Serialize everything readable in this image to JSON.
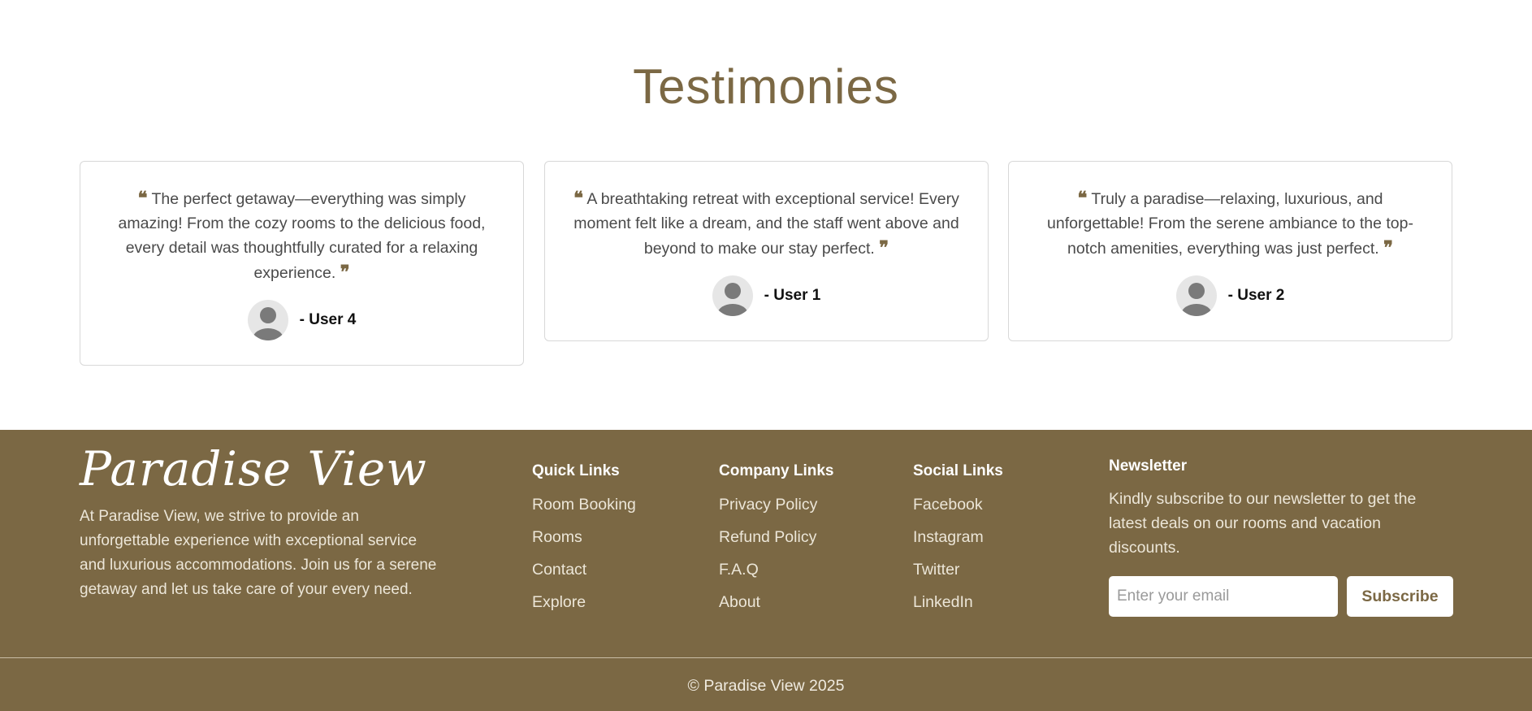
{
  "testimonies": {
    "title": "Testimonies",
    "items": [
      {
        "quote": "The perfect getaway—everything was simply amazing! From the cozy rooms to the delicious food, every detail was thoughtfully curated for a relaxing experience.",
        "author": "- User 4"
      },
      {
        "quote": "A breathtaking retreat with exceptional service! Every moment felt like a dream, and the staff went above and beyond to make our stay perfect.",
        "author": "- User 1"
      },
      {
        "quote": "Truly a paradise—relaxing, luxurious, and unforgettable! From the serene ambiance to the top-notch amenities, everything was just perfect.",
        "author": "- User 2"
      }
    ],
    "quote_open": "❝",
    "quote_close": "❞"
  },
  "footer": {
    "brand": "Paradise View",
    "about": "At Paradise View, we strive to provide an unforgettable experience with exceptional service and luxurious accommodations. Join us for a serene getaway and let us take care of your every need.",
    "quick_links": {
      "title": "Quick Links",
      "items": [
        "Room Booking",
        "Rooms",
        "Contact",
        "Explore"
      ]
    },
    "company_links": {
      "title": "Company Links",
      "items": [
        "Privacy Policy",
        "Refund Policy",
        "F.A.Q",
        "About"
      ]
    },
    "social_links": {
      "title": "Social Links",
      "items": [
        "Facebook",
        "Instagram",
        "Twitter",
        "LinkedIn"
      ]
    },
    "newsletter": {
      "title": "Newsletter",
      "text": "Kindly subscribe to our newsletter to get the latest deals on our rooms and vacation discounts.",
      "placeholder": "Enter your email",
      "value": "",
      "button": "Subscribe"
    },
    "copyright": "© Paradise View 2025"
  },
  "colors": {
    "accent": "#7b6844",
    "footer_bg": "#7b6844",
    "card_border": "#d8d8d8"
  },
  "icons": {
    "quote_open": "quote-left-icon",
    "quote_close": "quote-right-icon",
    "avatar": "user-avatar-icon"
  }
}
